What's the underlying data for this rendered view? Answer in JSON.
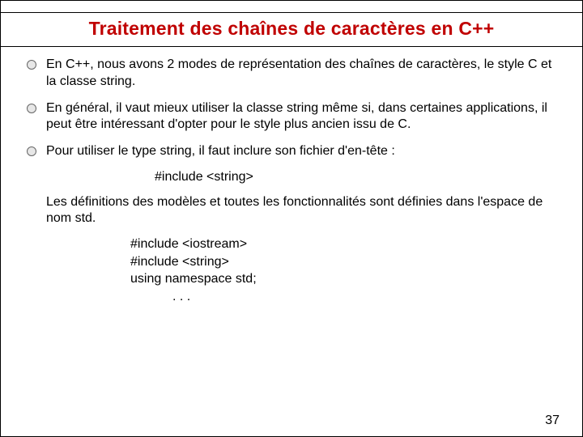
{
  "title": "Traitement des chaînes de caractères en C++",
  "bullets": [
    "En C++, nous avons 2 modes de représentation des chaînes de caractères, le style C et la classe string.",
    "En général, il vaut mieux utiliser la classe string même si, dans certaines applications, il peut être intéressant d'opter pour le style plus ancien issu de C.",
    "Pour utiliser le type string, il faut inclure son fichier d'en-tête :"
  ],
  "code1": {
    "line1": "#include <string>"
  },
  "paragraph": "Les définitions des modèles et toutes les fonctionnalités sont définies dans l'espace de nom std.",
  "code2": {
    "line1": "#include <iostream>",
    "line2": "#include <string>",
    "line3": "using namespace std;",
    "line4": ". . ."
  },
  "page_number": "37"
}
